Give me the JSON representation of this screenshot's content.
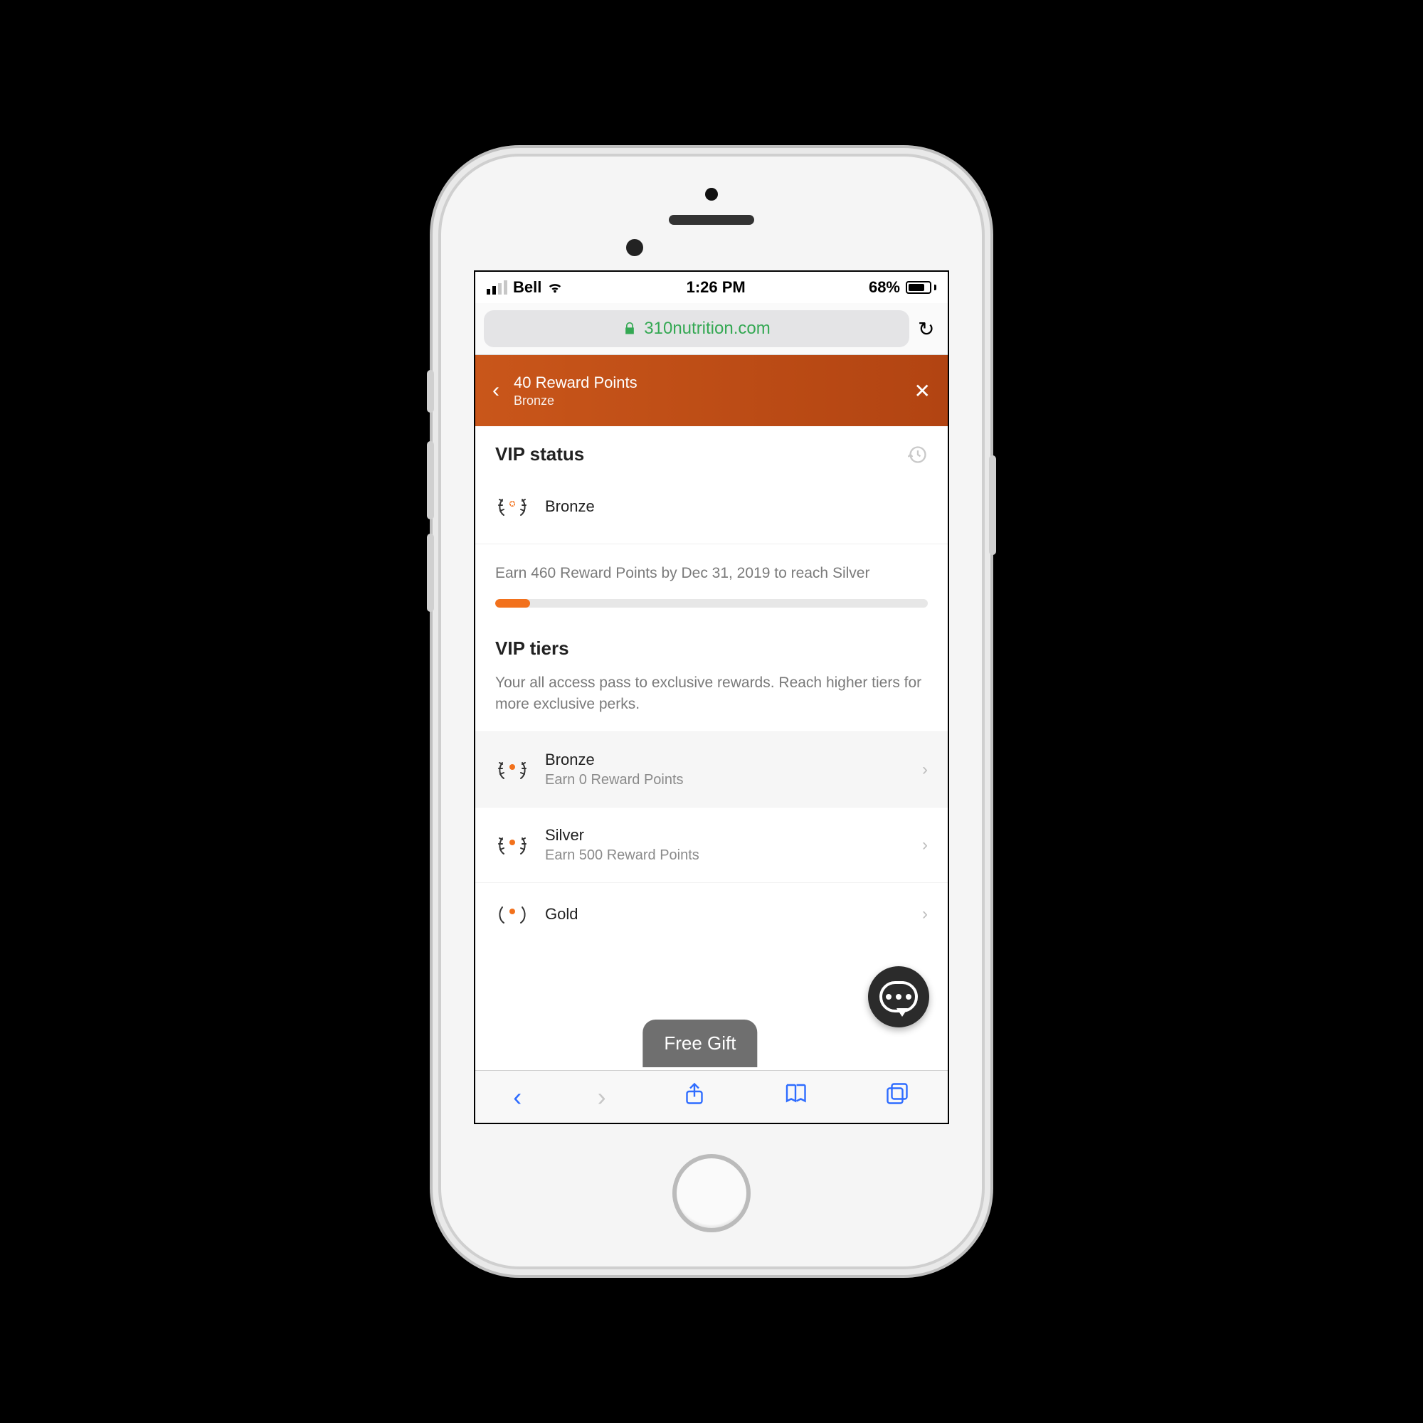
{
  "status": {
    "carrier": "Bell",
    "time": "1:26 PM",
    "battery_pct": "68%"
  },
  "browser": {
    "domain": "310nutrition.com"
  },
  "header": {
    "title": "40 Reward Points",
    "subtitle": "Bronze"
  },
  "vip_status": {
    "section_label": "VIP status",
    "current_tier": "Bronze",
    "progress_text": "Earn 460 Reward Points by Dec 31, 2019 to reach Silver",
    "progress_pct": 8
  },
  "vip_tiers": {
    "title": "VIP tiers",
    "description": "Your all access pass to exclusive rewards. Reach higher tiers for more exclusive perks.",
    "items": [
      {
        "name": "Bronze",
        "sub": "Earn 0 Reward Points"
      },
      {
        "name": "Silver",
        "sub": "Earn 500 Reward Points"
      },
      {
        "name": "Gold",
        "sub": ""
      }
    ]
  },
  "promo": {
    "free_gift_label": "Free Gift"
  }
}
